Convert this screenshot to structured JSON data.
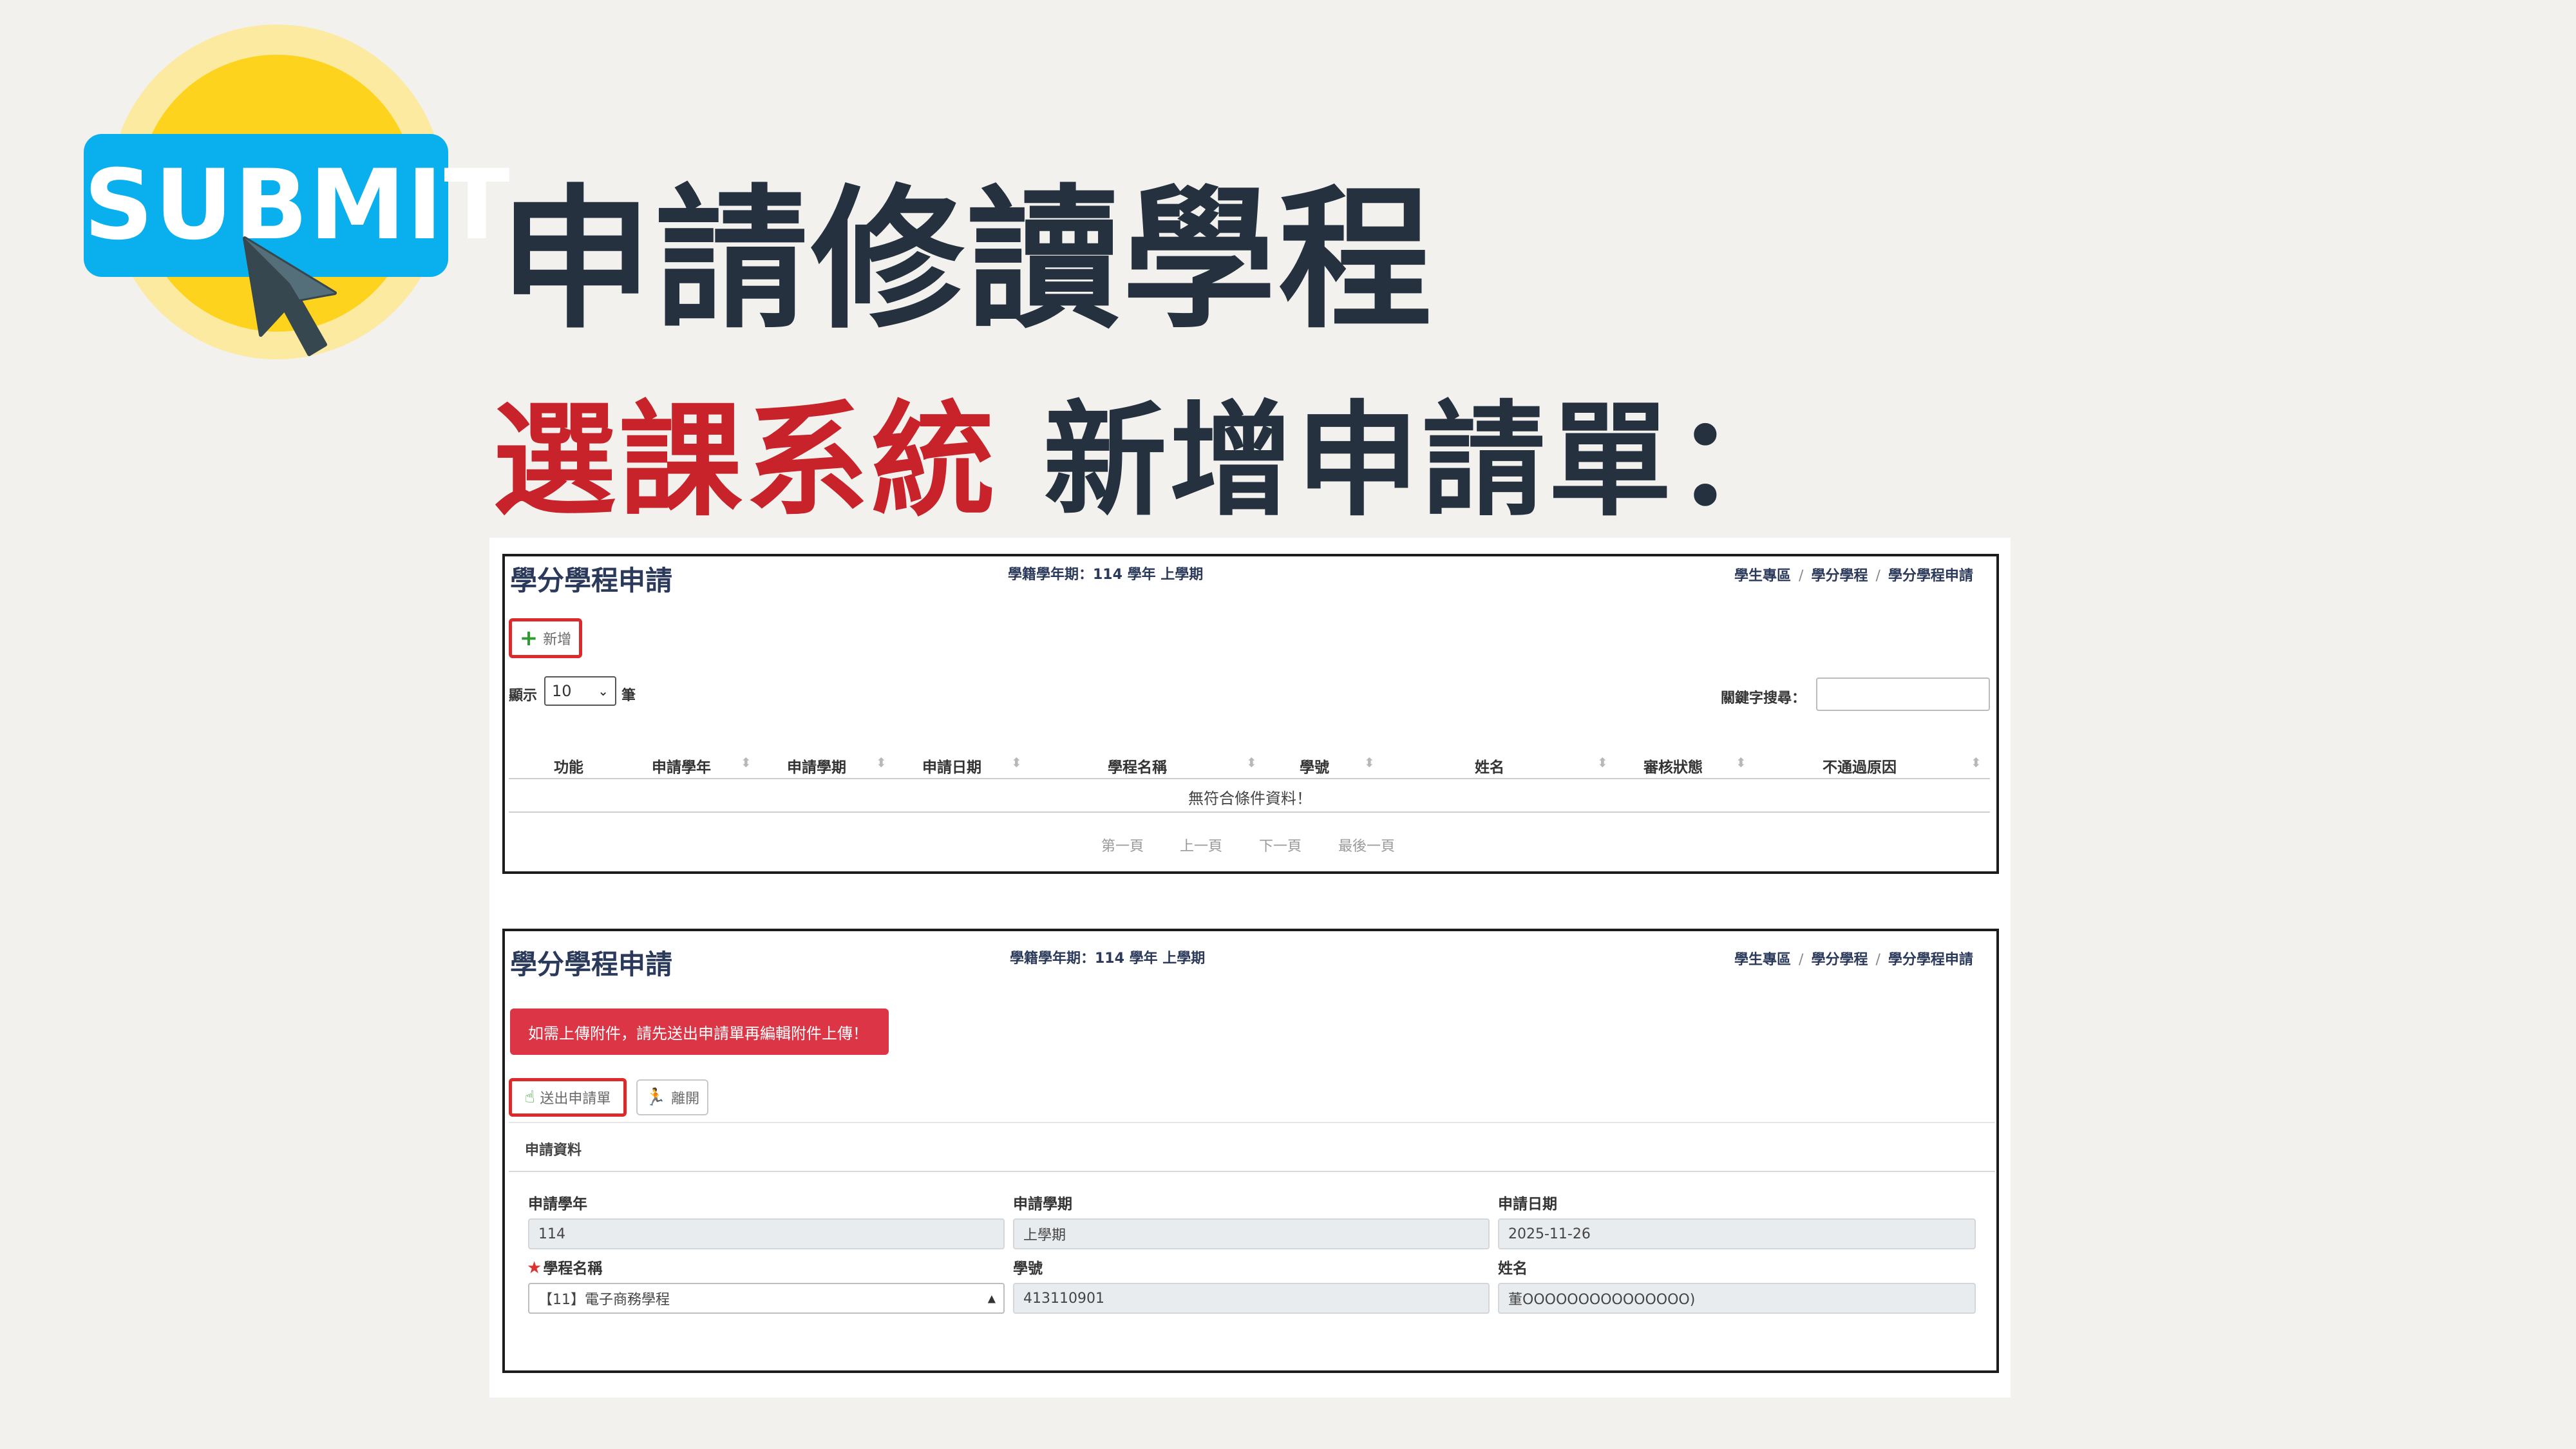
{
  "logo": {
    "text": "SUBMIT",
    "icon": "cursor-icon",
    "colors": {
      "bar": "#0ab0ee",
      "sun": "#fdd31e",
      "halo": "#fbeaa0"
    }
  },
  "header": {
    "title": "申請修讀學程",
    "subtitle_red": "選課系統",
    "subtitle_dark": "新增申請單："
  },
  "colors": {
    "title": "#25313f",
    "accent_red": "#c8222a",
    "alert": "#dc3545",
    "highlight": "#dc2a2a"
  },
  "panel1": {
    "title": "學分學程申請",
    "year": "學籍學年期：114 學年 上學期",
    "breadcrumb": [
      "學生專區",
      "學分學程",
      "學分學程申請"
    ],
    "add_button": "新增",
    "show_prefix": "顯示",
    "show_value": "10",
    "show_suffix": "筆",
    "search_label": "關鍵字搜尋：",
    "search_value": "",
    "columns": [
      "功能",
      "申請學年",
      "申請學期",
      "申請日期",
      "學程名稱",
      "學號",
      "姓名",
      "審核狀態",
      "不通過原因"
    ],
    "empty_text": "無符合條件資料！",
    "pager": [
      "第一頁",
      "上一頁",
      "下一頁",
      "最後一頁"
    ]
  },
  "panel2": {
    "title": "學分學程申請",
    "year": "學籍學年期：114 學年 上學期",
    "breadcrumb": [
      "學生專區",
      "學分學程",
      "學分學程申請"
    ],
    "alert": "如需上傳附件，請先送出申請單再編輯附件上傳！",
    "submit_button": "送出申請單",
    "leave_button": "離開",
    "section": "申請資料",
    "fields": {
      "apply_year_label": "申請學年",
      "apply_year": "114",
      "apply_term_label": "申請學期",
      "apply_term": "上學期",
      "apply_date_label": "申請日期",
      "apply_date": "2025-11-26",
      "program_label": "學程名稱",
      "program": "【11】電子商務學程",
      "student_id_label": "學號",
      "student_id": "413110901",
      "name_label": "姓名",
      "name": "董OOOOOOOOOOOOOOO)"
    }
  }
}
